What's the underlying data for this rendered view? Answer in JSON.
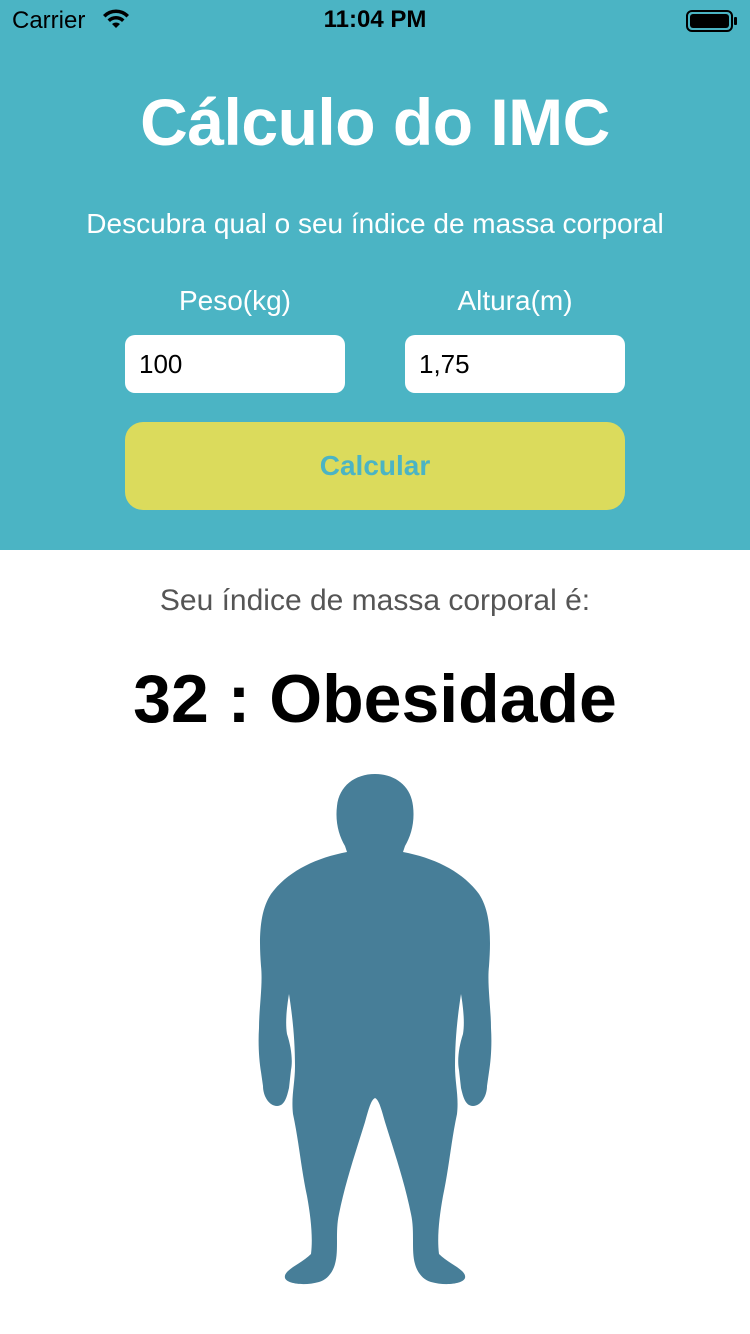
{
  "status_bar": {
    "carrier": "Carrier",
    "time": "11:04 PM",
    "icons": [
      "wifi-icon",
      "battery-icon"
    ]
  },
  "header": {
    "title": "Cálculo do IMC",
    "subtitle": "Descubra qual o seu índice de massa corporal"
  },
  "form": {
    "peso_label": "Peso(kg)",
    "peso_value": "100",
    "altura_label": "Altura(m)",
    "altura_value": "1,75",
    "button_label": "Calcular"
  },
  "result": {
    "caption": "Seu índice de massa corporal é:",
    "value": "32 : Obesidade",
    "image": "obese-person-silhouette"
  },
  "colors": {
    "header_bg": "#4bb4c4",
    "button_bg": "#dbdb5c",
    "figure": "#477e98"
  }
}
